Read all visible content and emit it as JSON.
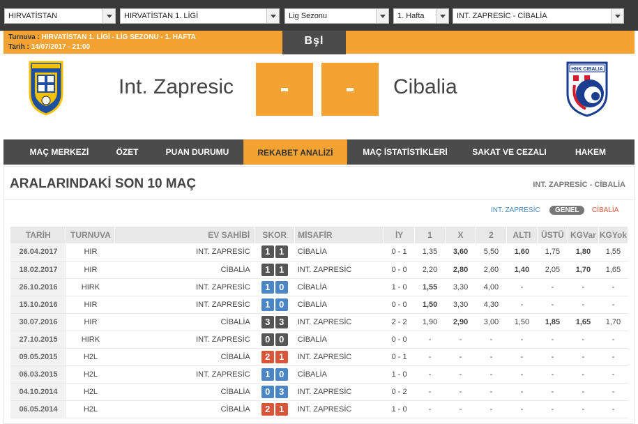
{
  "selectors": [
    {
      "value": "HIRVATİSTAN"
    },
    {
      "value": "HIRVATİSTAN 1. LİGİ"
    },
    {
      "value": "Lig Sezonu"
    },
    {
      "value": "1. Hafta"
    },
    {
      "value": "INT. ZAPRESİC - CİBALİA"
    }
  ],
  "info": {
    "tournament_label": "Turnuva",
    "tournament_value": "HIRVATİSTAN 1. LİGİ - LİG SEZONU - 1. HAFTA",
    "date_label": "Tarih",
    "date_value": "14/07/2017 - 21:00",
    "status": "Bşl"
  },
  "match": {
    "home_team": "Int. Zapresic",
    "away_team": "Cibalia",
    "home_score": "-",
    "away_score": "-",
    "home_crest_text": "NK INTER ZAPRESIC",
    "away_crest_text": "HNK CIBALIA"
  },
  "nav": {
    "tabs": [
      "MAÇ MERKEZİ",
      "ÖZET",
      "PUAN DURUMU",
      "REKABET ANALİZİ",
      "MAÇ İSTATİSTİKLERİ",
      "SAKAT VE CEZALI",
      "HAKEM"
    ],
    "active": "REKABET ANALİZİ"
  },
  "section": {
    "title": "ARALARINDAKİ SON 10 MAÇ",
    "matchup": "INT. ZAPRESİC - CİBALİA",
    "filters": {
      "home": "INT. ZAPRESİC",
      "general": "GENEL",
      "away": "CİBALİA"
    }
  },
  "table": {
    "headers": [
      "TARİH",
      "TURNUVA",
      "EV SAHİBİ",
      "SKOR",
      "MİSAFİR",
      "İY",
      "1",
      "X",
      "2",
      "ALTI",
      "ÜSTÜ",
      "KGVar",
      "KGYok"
    ],
    "rows": [
      {
        "date": "26.04.2017",
        "tour": "HIR",
        "home": "INT. ZAPRESİC",
        "hs": "1",
        "as": "1",
        "result": "draw",
        "away": "CİBALİA",
        "ht": "0 - 1",
        "o1": "1,35",
        "ox": "3,60",
        "o2": "5,50",
        "alt": "1,60",
        "ust": "1,75",
        "kgv": "1,80",
        "kgy": "1,55",
        "bold": [
          "ox",
          "alt",
          "kgv"
        ]
      },
      {
        "date": "18.02.2017",
        "tour": "HIR",
        "home": "CİBALİA",
        "hs": "1",
        "as": "1",
        "result": "draw",
        "away": "INT. ZAPRESİC",
        "ht": "0 - 0",
        "o1": "2,20",
        "ox": "2,80",
        "o2": "2,60",
        "alt": "1,40",
        "ust": "2,05",
        "kgv": "1,70",
        "kgy": "1,65",
        "bold": [
          "ox",
          "alt",
          "kgv"
        ]
      },
      {
        "date": "26.10.2016",
        "tour": "HIRK",
        "home": "INT. ZAPRESİC",
        "hs": "1",
        "as": "0",
        "result": "homewin",
        "away": "CİBALİA",
        "ht": "1 - 0",
        "o1": "1,55",
        "ox": "3,30",
        "o2": "4,00",
        "alt": "-",
        "ust": "-",
        "kgv": "-",
        "kgy": "-",
        "bold": [
          "o1"
        ]
      },
      {
        "date": "15.10.2016",
        "tour": "HIR",
        "home": "INT. ZAPRESİC",
        "hs": "1",
        "as": "0",
        "result": "homewin",
        "away": "CİBALİA",
        "ht": "0 - 0",
        "o1": "1,50",
        "ox": "3,30",
        "o2": "4,30",
        "alt": "-",
        "ust": "-",
        "kgv": "-",
        "kgy": "-",
        "bold": [
          "o1"
        ]
      },
      {
        "date": "30.07.2016",
        "tour": "HIR",
        "home": "CİBALİA",
        "hs": "3",
        "as": "3",
        "result": "draw",
        "away": "INT. ZAPRESİC",
        "ht": "2 - 2",
        "o1": "1,90",
        "ox": "2,90",
        "o2": "3,00",
        "alt": "1,50",
        "ust": "1,85",
        "kgv": "1,65",
        "kgy": "1,70",
        "bold": [
          "ox",
          "ust",
          "kgv"
        ]
      },
      {
        "date": "27.10.2015",
        "tour": "HIRK",
        "home": "INT. ZAPRESİC",
        "hs": "0",
        "as": "0",
        "result": "draw",
        "away": "CİBALİA",
        "ht": "0 - 0",
        "o1": "-",
        "ox": "-",
        "o2": "-",
        "alt": "-",
        "ust": "-",
        "kgv": "-",
        "kgy": "-",
        "bold": []
      },
      {
        "date": "09.05.2015",
        "tour": "H2L",
        "home": "CİBALİA",
        "hs": "2",
        "as": "1",
        "result": "awaywin",
        "away": "INT. ZAPRESİC",
        "ht": "0 - 1",
        "o1": "-",
        "ox": "-",
        "o2": "-",
        "alt": "-",
        "ust": "-",
        "kgv": "-",
        "kgy": "-",
        "bold": []
      },
      {
        "date": "06.03.2015",
        "tour": "H2L",
        "home": "INT. ZAPRESİC",
        "hs": "1",
        "as": "0",
        "result": "homewin",
        "away": "CİBALİA",
        "ht": "1 - 0",
        "o1": "-",
        "ox": "-",
        "o2": "-",
        "alt": "-",
        "ust": "-",
        "kgv": "-",
        "kgy": "-",
        "bold": []
      },
      {
        "date": "04.10.2014",
        "tour": "H2L",
        "home": "CİBALİA",
        "hs": "0",
        "as": "3",
        "result": "homewin",
        "away": "INT. ZAPRESİC",
        "ht": "0 - 2",
        "o1": "-",
        "ox": "-",
        "o2": "-",
        "alt": "-",
        "ust": "-",
        "kgv": "-",
        "kgy": "-",
        "bold": []
      },
      {
        "date": "06.05.2014",
        "tour": "H2L",
        "home": "CİBALİA",
        "hs": "2",
        "as": "1",
        "result": "awaywin",
        "away": "INT. ZAPRESİC",
        "ht": "1 - 0",
        "o1": "-",
        "ox": "-",
        "o2": "-",
        "alt": "-",
        "ust": "-",
        "kgv": "-",
        "kgy": "-",
        "bold": []
      }
    ]
  },
  "colors": {
    "accent": "#f4a333",
    "dark": "#4b4b4b",
    "home_win": "#4a86c5",
    "away_win": "#d9553a",
    "draw": "#555555"
  }
}
